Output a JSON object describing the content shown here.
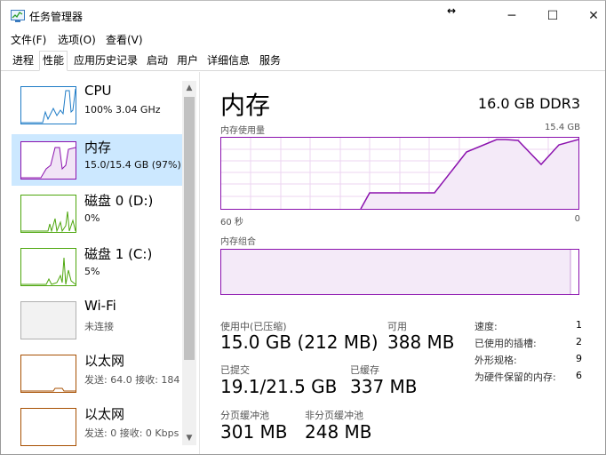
{
  "window": {
    "title": "任务管理器",
    "resize_glyph": "↔",
    "minimize": "─",
    "maximize": "☐",
    "close": "✕"
  },
  "menu": [
    "文件(F)",
    "选项(O)",
    "查看(V)"
  ],
  "tabs": [
    "进程",
    "性能",
    "应用历史记录",
    "启动",
    "用户",
    "详细信息",
    "服务"
  ],
  "sidebar": {
    "items": [
      {
        "title": "CPU",
        "sub": "100% 3.04 GHz",
        "color": "#1e7bc6"
      },
      {
        "title": "内存",
        "sub": "15.0/15.4 GB (97%)",
        "color": "#8b12ae"
      },
      {
        "title": "磁盘 0 (D:)",
        "sub": "0%",
        "color": "#4da60c"
      },
      {
        "title": "磁盘 1 (C:)",
        "sub": "5%",
        "color": "#4da60c"
      },
      {
        "title": "Wi-Fi",
        "sub": "未连接",
        "color": "#b0b0b0"
      },
      {
        "title": "以太网",
        "sub": "发送: 64.0 接收: 184",
        "color": "#a74f01"
      },
      {
        "title": "以太网",
        "sub": "发送: 0 接收: 0 Kbps",
        "color": "#a74f01"
      }
    ]
  },
  "main": {
    "title": "内存",
    "spec": "16.0 GB DDR3",
    "graph1": {
      "label": "内存使用量",
      "max_label": "15.4 GB",
      "time_left": "60 秒",
      "time_right": "0"
    },
    "graph2": {
      "label": "内存组合"
    },
    "stats": {
      "in_use_label": "使用中(已压缩)",
      "in_use_value": "15.0 GB (212 MB)",
      "available_label": "可用",
      "available_value": "388 MB",
      "committed_label": "已提交",
      "committed_value": "19.1/21.5 GB",
      "cached_label": "已缓存",
      "cached_value": "337 MB",
      "paged_label": "分页缓冲池",
      "paged_value": "301 MB",
      "nonpaged_label": "非分页缓冲池",
      "nonpaged_value": "248 MB"
    },
    "details": [
      {
        "label": "速度:",
        "value": "1"
      },
      {
        "label": "已使用的插槽:",
        "value": "2"
      },
      {
        "label": "外形规格:",
        "value": "9"
      },
      {
        "label": "为硬件保留的内存:",
        "value": "6"
      }
    ]
  }
}
